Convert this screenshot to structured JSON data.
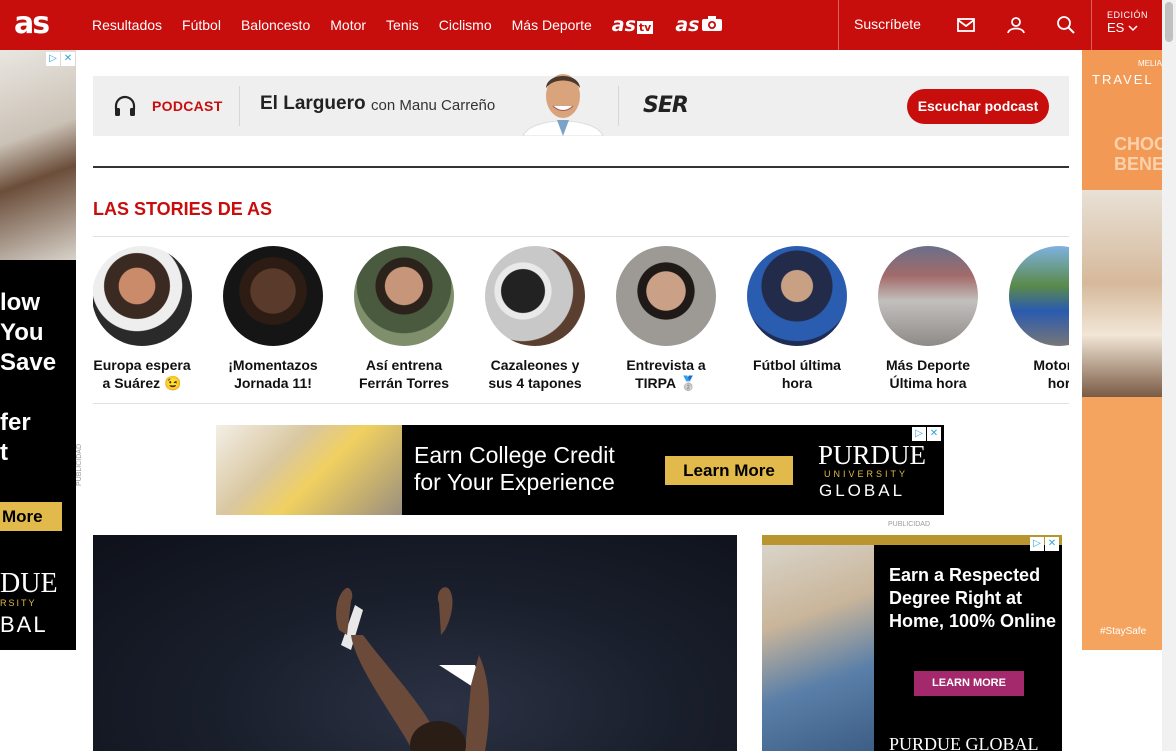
{
  "header": {
    "logo": "as",
    "nav": [
      "Resultados",
      "Fútbol",
      "Baloncesto",
      "Motor",
      "Tenis",
      "Ciclismo",
      "Más Deporte"
    ],
    "as_tv": "as",
    "as_tv_suffix": "tv",
    "as_photo": "as",
    "subscribe": "Suscríbete",
    "edition_label": "EDICIÓN",
    "edition_value": "ES",
    "colors": {
      "brand": "#c80d0d"
    }
  },
  "podcast": {
    "label": "PODCAST",
    "show": "El Larguero",
    "host": "con Manu Carreño",
    "network": "SER",
    "button": "Escuchar podcast"
  },
  "stories": {
    "title": "LAS STORIES DE AS",
    "items": [
      {
        "caption_line1": "Europa espera",
        "caption_line2": "a Suárez 😉"
      },
      {
        "caption_line1": "¡Momentazos",
        "caption_line2": "Jornada 11!"
      },
      {
        "caption_line1": "Así entrena",
        "caption_line2": "Ferrán Torres"
      },
      {
        "caption_line1": "Cazaleones y",
        "caption_line2": "sus 4 tapones"
      },
      {
        "caption_line1": "Entrevista a",
        "caption_line2": "TIRPA 🥈"
      },
      {
        "caption_line1": "Fútbol última",
        "caption_line2": "hora"
      },
      {
        "caption_line1": "Más Deporte",
        "caption_line2": "Última hora"
      },
      {
        "caption_line1": "Motor ú",
        "caption_line2": "hor"
      }
    ]
  },
  "ads": {
    "left": {
      "lines": [
        "low",
        "You",
        "Save",
        "fer",
        "t"
      ],
      "button": "More",
      "brand_line1": "DUE",
      "brand_line2": "RSITY",
      "brand_line3": "BAL"
    },
    "right": {
      "small": "MELIA",
      "line1": "TRAVEL",
      "line2": "CHOO",
      "line3": "BENE",
      "hashtag": "#StaySafe"
    },
    "banner": {
      "headline_line1": "Earn College Credit",
      "headline_line2": "for Your Experience",
      "button": "Learn More",
      "brand_line1": "PURDUE",
      "brand_line2": "UNIVERSITY",
      "brand_line3": "GLOBAL"
    },
    "side": {
      "headline_line1": "Earn a Respected",
      "headline_line2": "Degree Right at",
      "headline_line3": "Home, 100% Online",
      "button": "LEARN MORE",
      "brand": "PURDUE GLOBAL"
    },
    "publicidad": "PUBLICIDAD"
  }
}
